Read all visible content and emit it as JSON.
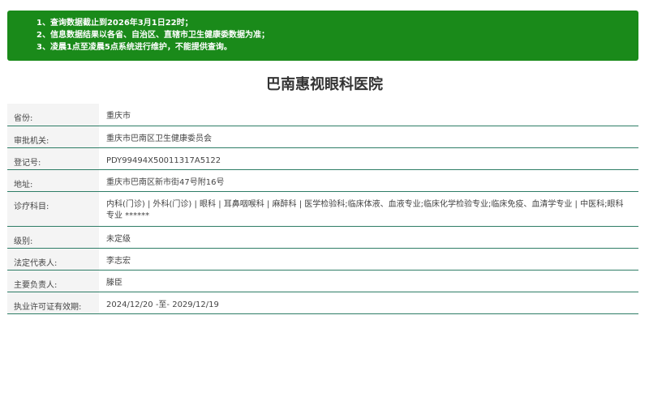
{
  "notice": {
    "lines": [
      "1、查询数据截止到2026年3月1日22时；",
      "2、信息数据结果以各省、自治区、直辖市卫生健康委数据为准；",
      "3、凌晨1点至凌晨5点系统进行维护，不能提供查询。"
    ],
    "background_color": "#1a8a1a"
  },
  "title": "巴南惠视眼科医院",
  "rows": [
    {
      "label": "省份:",
      "value": "重庆市"
    },
    {
      "label": "审批机关:",
      "value": "重庆市巴南区卫生健康委员会"
    },
    {
      "label": "登记号:",
      "value": "PDY99494X50011317A5122"
    },
    {
      "label": "地址:",
      "value": "重庆市巴南区新市街47号附16号"
    },
    {
      "label": "诊疗科目:",
      "value": "内科(门诊) | 外科(门诊) | 眼科 | 耳鼻咽喉科 | 麻醉科 | 医学检验科;临床体液、血液专业;临床化学检验专业;临床免疫、血清学专业 | 中医科;眼科专业 ******"
    },
    {
      "label": "级别:",
      "value": "未定级"
    },
    {
      "label": "法定代表人:",
      "value": "李志宏"
    },
    {
      "label": "主要负责人:",
      "value": "滕臣"
    },
    {
      "label": "执业许可证有效期:",
      "value": "2024/12/20 -至- 2029/12/19"
    }
  ],
  "colors": {
    "row_border": "#2e7d66",
    "label_background": "#f4f4f4"
  }
}
